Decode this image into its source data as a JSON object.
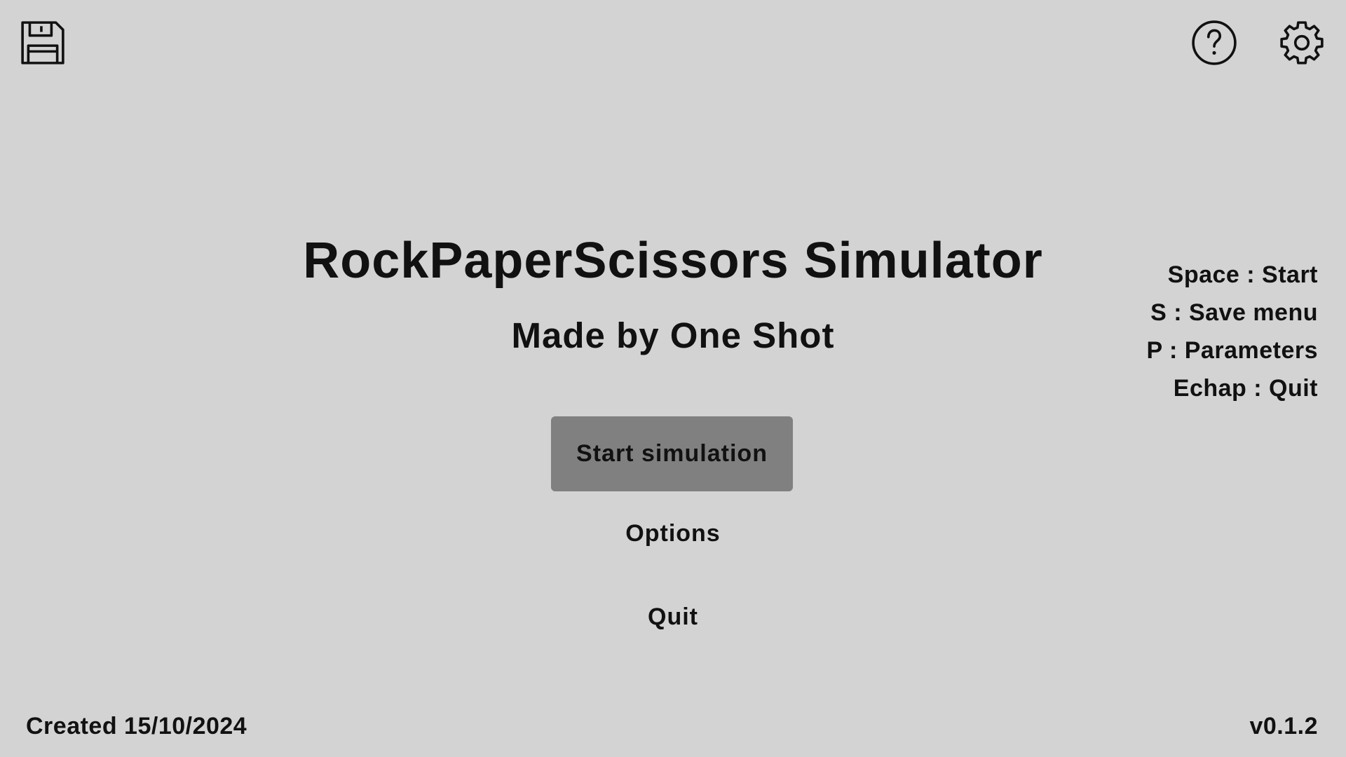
{
  "header": {
    "icons": [
      "floppy-disk-icon",
      "question-mark-icon",
      "gear-icon"
    ]
  },
  "main": {
    "title": "RockPaperScissors Simulator",
    "subtitle": "Made by One Shot",
    "buttons": {
      "start": "Start simulation",
      "options": "Options",
      "quit": "Quit"
    }
  },
  "shortcuts": [
    "Space : Start",
    "S : Save menu",
    "P : Parameters",
    "Echap : Quit"
  ],
  "footer": {
    "created": "Created 15/10/2024",
    "version": "v0.1.2"
  },
  "colors": {
    "background": "#d3d3d3",
    "primary_button": "#808080",
    "text": "#111111"
  }
}
